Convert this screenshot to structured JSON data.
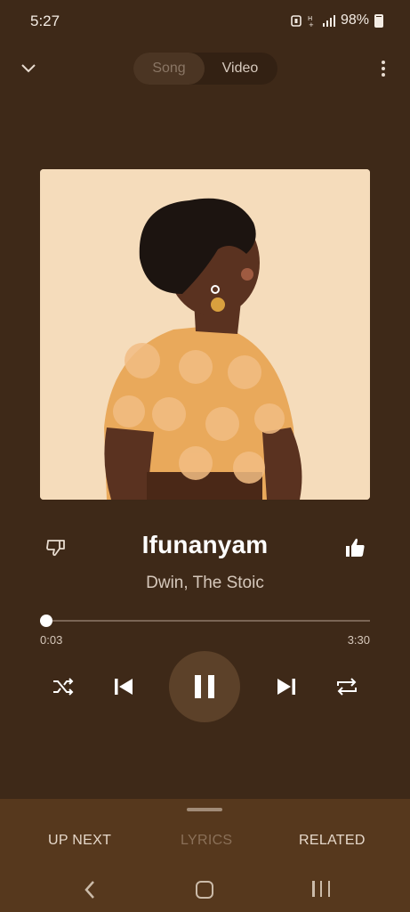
{
  "status_bar": {
    "time": "5:27",
    "battery": "98%",
    "icons": [
      "notification-icon",
      "network-hplus-icon",
      "signal-icon",
      "battery-icon"
    ]
  },
  "top_bar": {
    "tabs": [
      {
        "label": "Song",
        "selected": false
      },
      {
        "label": "Video",
        "selected": true
      }
    ],
    "icons": {
      "collapse": "chevron-down-icon",
      "menu": "more-vertical-icon"
    }
  },
  "album_art": {
    "subject": "album-cover-illustration"
  },
  "track": {
    "title": "Ifunanyam",
    "artist": "Dwin, The Stoic",
    "liked": true
  },
  "progress": {
    "current": "0:03",
    "total": "3:30",
    "fraction": 0.014
  },
  "controls": {
    "state": "playing",
    "icons": [
      "shuffle-icon",
      "skip-previous-icon",
      "pause-icon",
      "skip-next-icon",
      "repeat-icon"
    ]
  },
  "bottom_tabs": [
    {
      "label": "UP NEXT",
      "enabled": true
    },
    {
      "label": "LYRICS",
      "enabled": false
    },
    {
      "label": "RELATED",
      "enabled": true
    }
  ],
  "colors": {
    "background": "#3e2918",
    "sheet": "#56381d",
    "accent": "#ffffff",
    "muted": "#d6c8bb"
  }
}
